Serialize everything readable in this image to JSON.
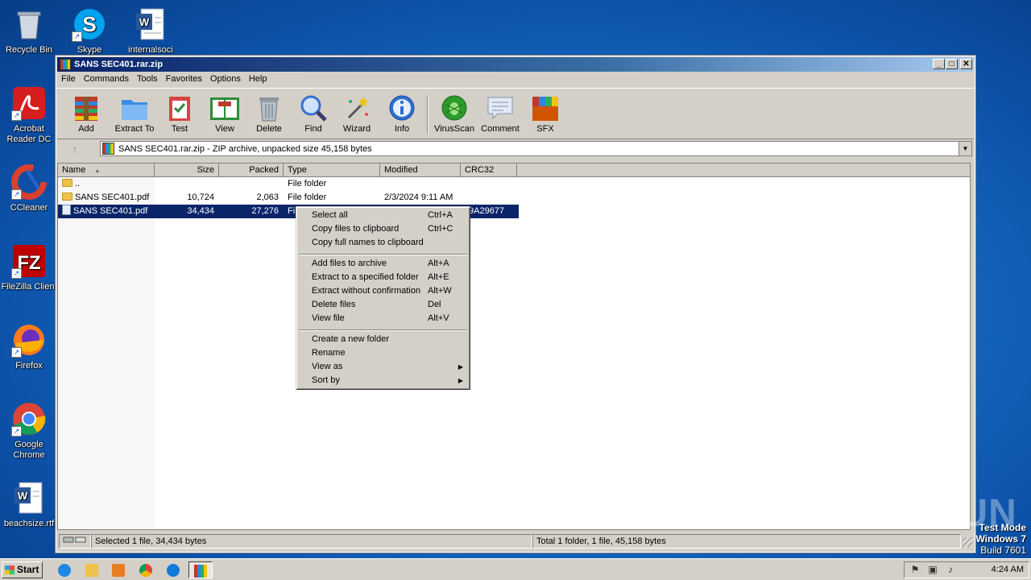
{
  "desktop": {
    "icons": [
      {
        "label": "Recycle Bin",
        "icon": "recycle-bin-icon"
      },
      {
        "label": "Skype",
        "icon": "skype-icon"
      },
      {
        "label": "internalsoci",
        "icon": "word-document-icon"
      },
      {
        "label": "Acrobat Reader DC",
        "icon": "acrobat-icon"
      },
      {
        "label": "CCleaner",
        "icon": "ccleaner-icon"
      },
      {
        "label": "FileZilla Client",
        "icon": "filezilla-icon"
      },
      {
        "label": "Firefox",
        "icon": "firefox-icon"
      },
      {
        "label": "Google Chrome",
        "icon": "chrome-icon"
      },
      {
        "label": "beachsize.rtf",
        "icon": "word-document-icon"
      }
    ]
  },
  "window": {
    "title": "SANS SEC401.rar.zip",
    "controls": {
      "minimize": "_",
      "maximize": "□",
      "close": "✕"
    },
    "menu": [
      "File",
      "Commands",
      "Tools",
      "Favorites",
      "Options",
      "Help"
    ],
    "toolbar": [
      {
        "label": "Add",
        "icon": "add-archive-icon",
        "color": "#c0392b"
      },
      {
        "label": "Extract To",
        "icon": "extract-folder-icon",
        "color": "#3a8ee6"
      },
      {
        "label": "Test",
        "icon": "test-clipboard-icon",
        "color": "#d64541"
      },
      {
        "label": "View",
        "icon": "view-book-icon",
        "color": "#2e8b3a"
      },
      {
        "label": "Delete",
        "icon": "delete-trash-icon",
        "color": "#8a949e"
      },
      {
        "label": "Find",
        "icon": "find-magnifier-icon",
        "color": "#3a6fcf"
      },
      {
        "label": "Wizard",
        "icon": "wizard-wand-icon",
        "color": "#c9a227"
      },
      {
        "label": "Info",
        "icon": "info-icon",
        "color": "#2f6fd0"
      },
      {
        "label": "VirusScan",
        "icon": "virusscan-bug-icon",
        "color": "#2c9a2c"
      },
      {
        "label": "Comment",
        "icon": "comment-icon",
        "color": "#7f93b0"
      },
      {
        "label": "SFX",
        "icon": "sfx-box-icon",
        "color": "#d35400"
      }
    ],
    "address": "SANS SEC401.rar.zip - ZIP archive, unpacked size 45,158 bytes",
    "columns": [
      "Name",
      "Size",
      "Packed",
      "Type",
      "Modified",
      "CRC32"
    ],
    "sort_arrow": "▲",
    "rows": [
      {
        "name": "..",
        "size": "",
        "packed": "",
        "type": "File folder",
        "modified": "",
        "crc": "",
        "kind": "folder"
      },
      {
        "name": "SANS SEC401.pdf",
        "size": "10,724",
        "packed": "2,063",
        "type": "File folder",
        "modified": "2/3/2024 9:11 AM",
        "crc": "",
        "kind": "folder"
      },
      {
        "name": "SANS SEC401.pdf",
        "size": "34,434",
        "packed": "27,276",
        "type": "Fi",
        "modified": "",
        "crc": "9A29677",
        "kind": "file",
        "selected": true
      }
    ],
    "status_left": "Selected 1 file, 34,434 bytes",
    "status_right": "Total 1 folder, 1 file, 45,158 bytes"
  },
  "context_menu": {
    "items": [
      {
        "label": "Select all",
        "key": "Ctrl+A"
      },
      {
        "label": "Copy files to clipboard",
        "key": "Ctrl+C"
      },
      {
        "label": "Copy full names to clipboard",
        "key": ""
      },
      {
        "separator": true
      },
      {
        "label": "Add files to archive",
        "key": "Alt+A"
      },
      {
        "label": "Extract to a specified folder",
        "key": "Alt+E"
      },
      {
        "label": "Extract without confirmation",
        "key": "Alt+W"
      },
      {
        "label": "Delete files",
        "key": "Del"
      },
      {
        "label": "View file",
        "key": "Alt+V"
      },
      {
        "separator": true
      },
      {
        "label": "Create a new folder",
        "key": ""
      },
      {
        "label": "Rename",
        "key": ""
      },
      {
        "label": "View as",
        "key": "",
        "submenu": true
      },
      {
        "label": "Sort by",
        "key": "",
        "submenu": true
      }
    ]
  },
  "watermark": "ANY RUN",
  "test_mode": {
    "line1": "Test Mode",
    "line2": "Windows 7",
    "line3": "Build 7601"
  },
  "taskbar": {
    "start": "Start",
    "apps": [
      {
        "icon": "ie-icon",
        "color": "#1e88e5"
      },
      {
        "icon": "explorer-folder-icon",
        "color": "#f0c24b"
      },
      {
        "icon": "media-player-icon",
        "color": "#e67e22"
      },
      {
        "icon": "chrome-icon",
        "color": "#34a853"
      },
      {
        "icon": "edge-icon",
        "color": "#0f7bd6"
      },
      {
        "icon": "winrar-icon",
        "color": "#8e44ad"
      }
    ],
    "clock": "4:24 AM"
  }
}
